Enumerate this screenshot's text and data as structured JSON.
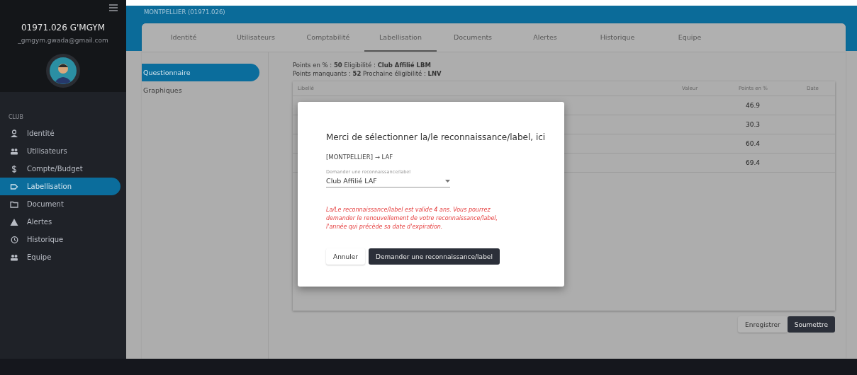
{
  "sidebar": {
    "user_name": "01971.026 G'MGYM",
    "user_email": "_gmgym.gwada@gmail.com",
    "section": "CLUB",
    "items": [
      {
        "label": "Identité",
        "selected": false
      },
      {
        "label": "Utilisateurs",
        "selected": false
      },
      {
        "label": "Compte/Budget",
        "selected": false
      },
      {
        "label": "Labellisation",
        "selected": true
      },
      {
        "label": "Document",
        "selected": false
      },
      {
        "label": "Alertes",
        "selected": false
      },
      {
        "label": "Historique",
        "selected": false
      },
      {
        "label": "Equipe",
        "selected": false
      }
    ]
  },
  "header": {
    "subtitle": "MONTPELLIER (01971.026)"
  },
  "tabs": [
    {
      "label": "Identité",
      "selected": false
    },
    {
      "label": "Utilisateurs",
      "selected": false
    },
    {
      "label": "Comptabilité",
      "selected": false
    },
    {
      "label": "Labellisation",
      "selected": true
    },
    {
      "label": "Documents",
      "selected": false
    },
    {
      "label": "Alertes",
      "selected": false
    },
    {
      "label": "Historique",
      "selected": false
    },
    {
      "label": "Equipe",
      "selected": false
    }
  ],
  "subnav": [
    {
      "label": "Questionnaire",
      "selected": true
    },
    {
      "label": "Graphiques",
      "selected": false
    }
  ],
  "summary": [
    "Points en % : **50**   Eligibilité : **Club Affilié LBM**",
    "Points manquants : **52** Prochaine éligibilité : **LNV**"
  ],
  "table": {
    "columns": [
      "Libellé",
      "Valeur",
      "Points en %",
      "Date"
    ],
    "rows": [
      {
        "points": "46.9"
      },
      {
        "points": "30.3"
      },
      {
        "points": "60.4"
      },
      {
        "points": "69.4"
      }
    ]
  },
  "actions": [
    {
      "label": "Enregistrer",
      "kind": "secondary"
    },
    {
      "label": "Soumettre",
      "kind": "primary"
    }
  ],
  "dialog": {
    "title": "Merci de sélectionner la/le reconnaissance/label, ici",
    "route": "[MONTPELLIER] → LAF",
    "select": {
      "label": "Demander une reconnaissance/label",
      "value": "Club Affilié LAF"
    },
    "notice": "La/Le reconnaissance/label est valide 4 ans. Vous pourrez demander le renouvellement de votre reconnaissance/label, l'année qui précède sa date d'expiration.",
    "buttons": [
      {
        "label": "Annuler",
        "kind": "secondary"
      },
      {
        "label": "Demander une reconnaissance/label",
        "kind": "primary"
      }
    ]
  }
}
